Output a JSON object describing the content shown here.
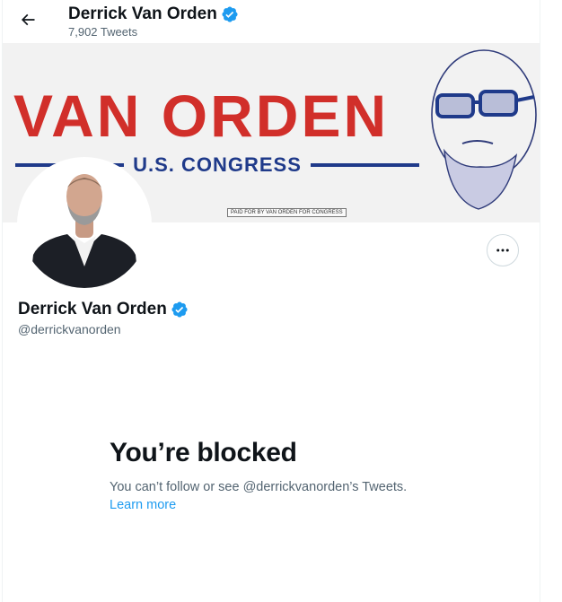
{
  "header": {
    "name": "Derrick Van Orden",
    "tweet_count": "7,902 Tweets"
  },
  "banner": {
    "title": "VAN ORDEN",
    "subtitle": "U.S. CONGRESS",
    "paid_for": "PAID FOR BY VAN ORDEN FOR CONGRESS"
  },
  "profile": {
    "name": "Derrick Van Orden",
    "handle": "@derrickvanorden"
  },
  "blocked": {
    "title": "You’re blocked",
    "description": "You can’t follow or see @derrickvanorden’s Tweets.",
    "learn_more": "Learn more"
  },
  "colors": {
    "accent": "#1d9bf0",
    "banner_red": "#d12f2a",
    "banner_blue": "#1f3a8a",
    "muted_text": "#536471"
  },
  "icons": {
    "back": "back-arrow-icon",
    "verified": "verified-badge-icon",
    "more": "more-horizontal-icon"
  }
}
